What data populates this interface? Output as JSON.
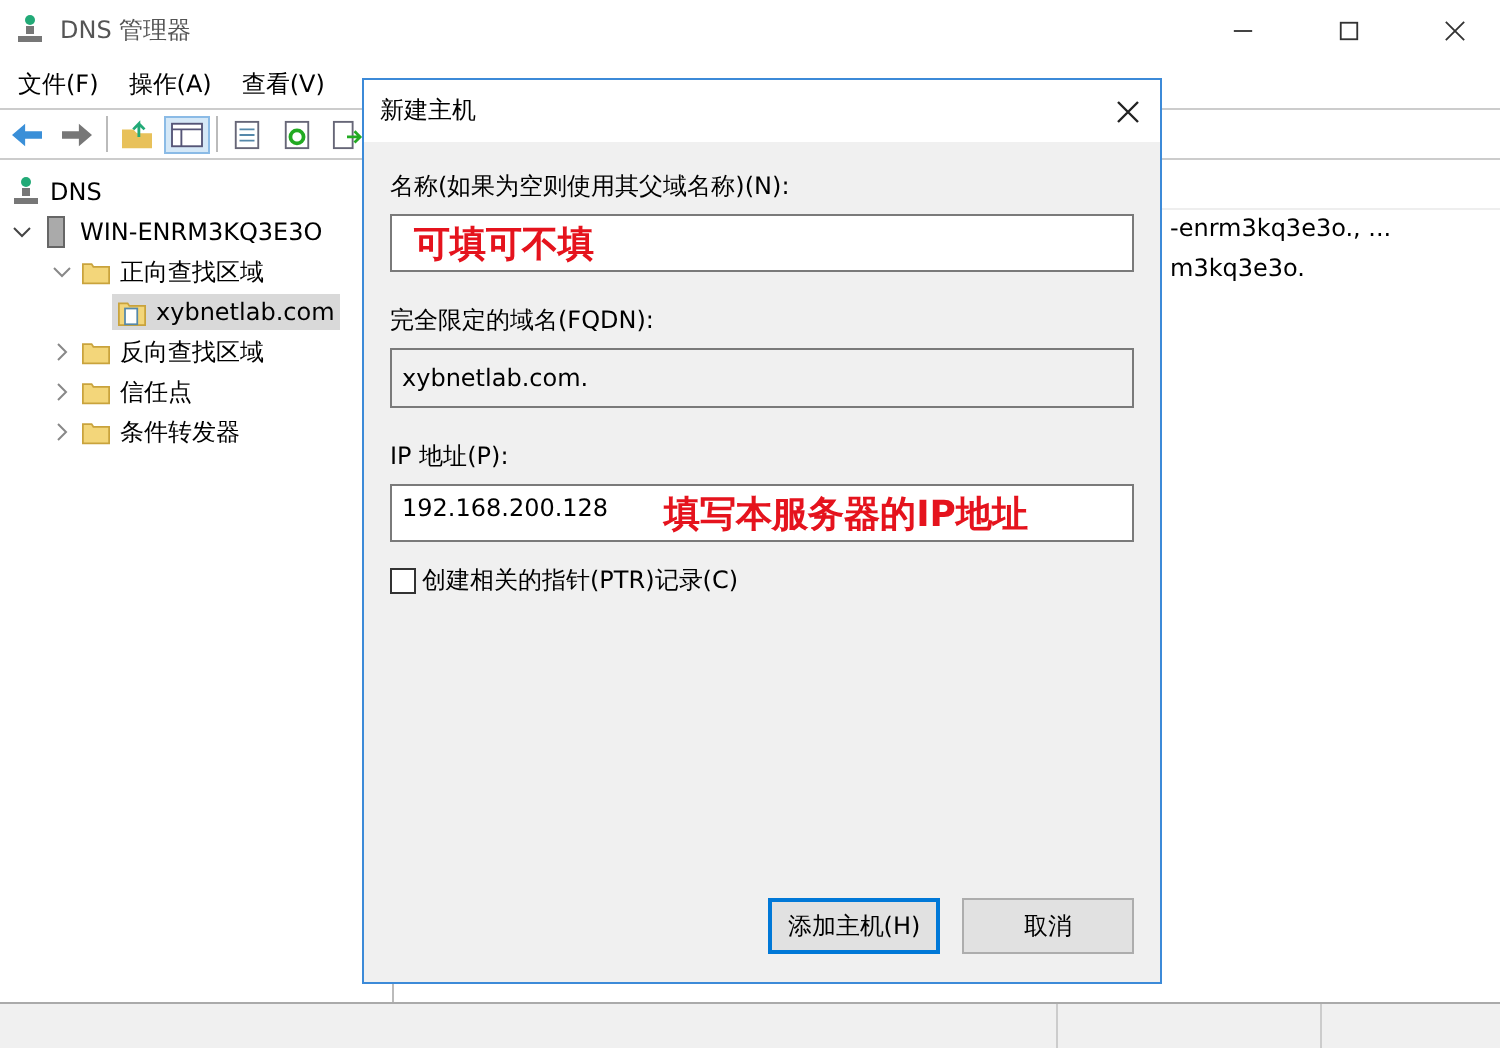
{
  "window": {
    "title": "DNS 管理器"
  },
  "menu": [
    "文件(F)",
    "操作(A)",
    "查看(V)"
  ],
  "tree": {
    "label": "DNS",
    "children": [
      {
        "label": "WIN-ENRM3KQ3E3O",
        "expanded": true,
        "children": [
          {
            "label": "正向查找区域",
            "expanded": true,
            "children": [
              {
                "label": "xybnetlab.com",
                "selected": true
              }
            ]
          },
          {
            "label": "反向查找区域",
            "expanded": false
          },
          {
            "label": "信任点",
            "expanded": false
          },
          {
            "label": "条件转发器",
            "expanded": false
          }
        ]
      }
    ]
  },
  "right_pane": {
    "rows": [
      "-enrm3kq3e3o., ...",
      "m3kq3e3o."
    ]
  },
  "dialog": {
    "title": "新建主机",
    "name_label": "名称(如果为空则使用其父域名称)(N):",
    "name_note": "可填可不填",
    "fqdn_label": "完全限定的域名(FQDN):",
    "fqdn_value": "xybnetlab.com.",
    "ip_label": "IP 地址(P):",
    "ip_value": "192.168.200.128",
    "ip_note": "填写本服务器的IP地址",
    "ptr": {
      "label": "创建相关的指针(PTR)记录(C)",
      "checked": false
    },
    "buttons": [
      {
        "label": "添加主机(H)",
        "default": true
      },
      {
        "label": "取消",
        "default": false
      }
    ]
  }
}
